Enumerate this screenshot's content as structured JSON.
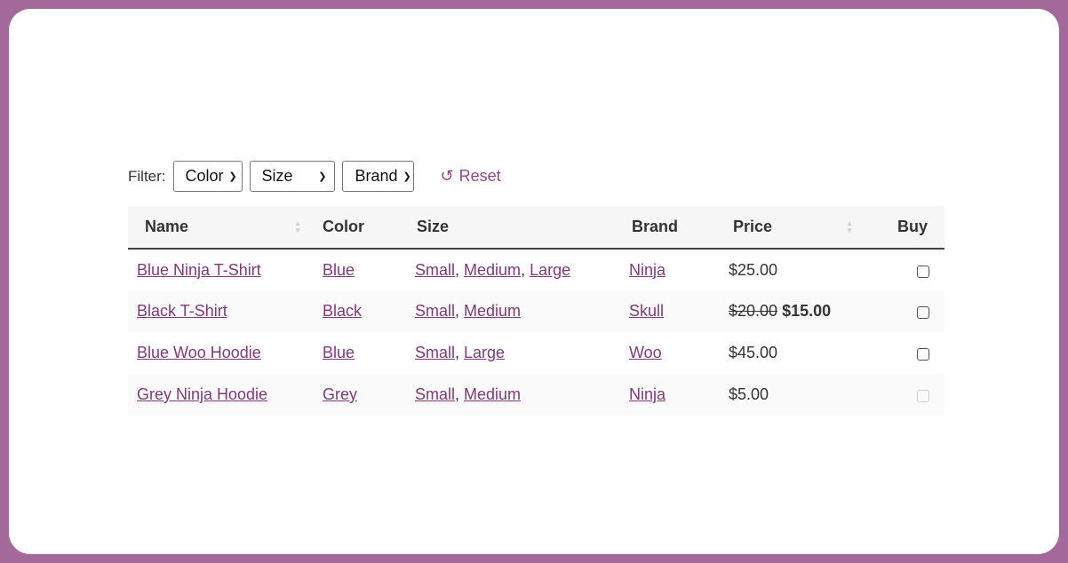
{
  "filter": {
    "label": "Filter:",
    "selects": [
      {
        "value": "Color"
      },
      {
        "value": "Size"
      },
      {
        "value": "Brand"
      }
    ],
    "reset_label": "Reset"
  },
  "table": {
    "headers": [
      "Name",
      "Color",
      "Size",
      "Brand",
      "Price",
      "Buy"
    ],
    "rows": [
      {
        "name": "Blue Ninja T-Shirt",
        "color": "Blue",
        "sizes": [
          "Small",
          "Medium",
          "Large"
        ],
        "brand": "Ninja",
        "price": "$25.00",
        "old_price": "",
        "buy_enabled": true
      },
      {
        "name": "Black T-Shirt",
        "color": "Black",
        "sizes": [
          "Small",
          "Medium"
        ],
        "brand": "Skull",
        "price": "$15.00",
        "old_price": "$20.00",
        "buy_enabled": true
      },
      {
        "name": "Blue Woo Hoodie",
        "color": "Blue",
        "sizes": [
          "Small",
          "Large"
        ],
        "brand": "Woo",
        "price": "$45.00",
        "old_price": "",
        "buy_enabled": true
      },
      {
        "name": "Grey Ninja Hoodie",
        "color": "Grey",
        "sizes": [
          "Small",
          "Medium"
        ],
        "brand": "Ninja",
        "price": "$5.00",
        "old_price": "",
        "buy_enabled": false
      }
    ]
  },
  "colors": {
    "frame": "#a4699b",
    "link": "#7d3b78"
  }
}
